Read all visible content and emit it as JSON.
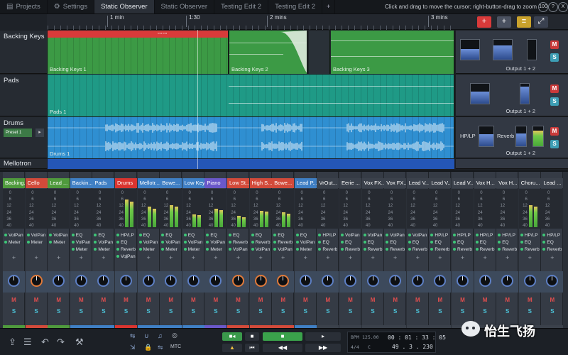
{
  "tabs": [
    {
      "label": "Projects",
      "icon": "folder-icon"
    },
    {
      "label": "Settings",
      "icon": "gear-icon"
    },
    {
      "label": "Static Observer",
      "active": true
    },
    {
      "label": "Static Observer"
    },
    {
      "label": "Testing Edit 2"
    },
    {
      "label": "Testing Edit 2"
    }
  ],
  "hint": "Click and drag to move the cursor; right-button-drag to zoom",
  "zoom": {
    "level": "100",
    "b1": "?",
    "b2": "X"
  },
  "ruler": {
    "marks": [
      "1 min",
      "1:30",
      "2 mins",
      "3 mins"
    ]
  },
  "tracks": [
    {
      "name": "Backing Keys",
      "output": "Output 1 + 2",
      "clips": [
        "Backing Keys 1",
        "Backing Keys 2",
        "Backing Keys 3"
      ]
    },
    {
      "name": "Pads",
      "output": "Output 1 + 2",
      "clips": [
        "Pads 1"
      ]
    },
    {
      "name": "Drums",
      "output": "Output 1 + 2",
      "clips": [
        "Drums 1"
      ],
      "preset": "Preset 1",
      "fx": [
        "HP/LP",
        "Reverb"
      ]
    },
    {
      "name": "Mellotron"
    }
  ],
  "side_buttons": {
    "mute": "M",
    "solo": "S"
  },
  "mixer": {
    "scale": [
      "0",
      "6",
      "12",
      "24",
      "36",
      "40"
    ],
    "plus": "+",
    "mute": "M",
    "solo": "S",
    "channels": [
      {
        "name": "Backing...",
        "color": "#4f9a3d",
        "plugins": [
          "VolPan",
          "Meter"
        ],
        "meter": 0
      },
      {
        "name": "Cello",
        "color": "#d24a3a",
        "plugins": [
          "VolPan",
          "Meter"
        ],
        "meter": 0
      },
      {
        "name": "Lead ...",
        "color": "#4f9a3d",
        "plugins": [
          "VolPan",
          "Meter"
        ],
        "meter": 0
      },
      {
        "name": "Backin...",
        "color": "#3f7fc4",
        "plugins": [
          "EQ",
          "VolPan",
          "Meter"
        ],
        "meter": 0
      },
      {
        "name": "Pads",
        "color": "#3f7fc4",
        "plugins": [
          "EQ",
          "VolPan",
          "Meter"
        ],
        "meter": 0
      },
      {
        "name": "Drums",
        "color": "#d9342f",
        "plugins": [
          "HP/LP",
          "EQ",
          "Reverb",
          "VolPan"
        ],
        "meter": 0.75
      },
      {
        "name": "Mellotr...",
        "color": "#3f7fc4",
        "plugins": [
          "EQ",
          "VolPan",
          "Meter"
        ],
        "meter": 0.55
      },
      {
        "name": "Bowe...",
        "color": "#3f7fc4",
        "plugins": [
          "EQ",
          "VolPan",
          "Meter"
        ],
        "meter": 0.6
      },
      {
        "name": "Low Key...",
        "color": "#3f7fc4",
        "plugins": [
          "EQ",
          "VolPan",
          "Meter"
        ],
        "meter": 0.35
      },
      {
        "name": "Piano",
        "color": "#6a58c9",
        "plugins": [
          "EQ",
          "VolPan",
          "Meter"
        ],
        "meter": 0.5
      },
      {
        "name": "Low St...",
        "color": "#d24a3a",
        "plugins": [
          "EQ",
          "Reverb",
          "VolPan"
        ],
        "meter": 0.3
      },
      {
        "name": "High S...",
        "color": "#d24a3a",
        "plugins": [
          "EQ",
          "Reverb",
          "VolPan"
        ],
        "meter": 0.45
      },
      {
        "name": "Bowe...",
        "color": "#d24a3a",
        "plugins": [
          "EQ",
          "Reverb",
          "VolPan"
        ],
        "meter": 0.4
      },
      {
        "name": "Lead P...",
        "color": "#3f7fc4",
        "plugins": [
          "EQ",
          "VolPan",
          "Meter"
        ],
        "meter": 0
      },
      {
        "name": "VrOut...",
        "color": "#3b414b",
        "plugins": [
          "HP/LP",
          "EQ",
          "Reverb"
        ],
        "meter": 0
      },
      {
        "name": "Eerie ...",
        "color": "#3b414b",
        "plugins": [
          "VolPan",
          "EQ",
          "Reverb"
        ],
        "meter": 0
      },
      {
        "name": "Vox FX...",
        "color": "#3b414b",
        "plugins": [
          "VolPan",
          "EQ",
          "Reverb"
        ],
        "meter": 0
      },
      {
        "name": "Vox FX...",
        "color": "#3b414b",
        "plugins": [
          "VolPan",
          "EQ",
          "Reverb"
        ],
        "meter": 0
      },
      {
        "name": "Lead V...",
        "color": "#3b414b",
        "plugins": [
          "VolPan",
          "EQ",
          "Reverb"
        ],
        "meter": 0
      },
      {
        "name": "Lead V...",
        "color": "#3b414b",
        "plugins": [
          "HP/LP",
          "EQ",
          "Reverb"
        ],
        "meter": 0
      },
      {
        "name": "Lead V...",
        "color": "#3b414b",
        "plugins": [
          "HP/LP",
          "EQ",
          "Reverb"
        ],
        "meter": 0
      },
      {
        "name": "Vox H...",
        "color": "#3b414b",
        "plugins": [
          "HP/LP",
          "EQ",
          "Reverb"
        ],
        "meter": 0
      },
      {
        "name": "Vox H...",
        "color": "#3b414b",
        "plugins": [
          "HP/LP",
          "EQ",
          "Reverb"
        ],
        "meter": 0
      },
      {
        "name": "Choru...",
        "color": "#3b414b",
        "plugins": [
          "HP/LP",
          "EQ",
          "Reverb"
        ],
        "meter": 0.6
      },
      {
        "name": "Lead ...",
        "color": "#3b414b",
        "plugins": [
          "HP/LP",
          "EQ",
          "Reverb"
        ],
        "meter": 0
      }
    ]
  },
  "transport": {
    "mtc": "MTC",
    "bpm_label": "BPM",
    "bpm": "125.00",
    "timesig": "4/4",
    "key": "C",
    "time": "00 : 01 : 33 : 05",
    "bars": "49 . 3 . 230"
  },
  "watermark": "怡生飞扬"
}
